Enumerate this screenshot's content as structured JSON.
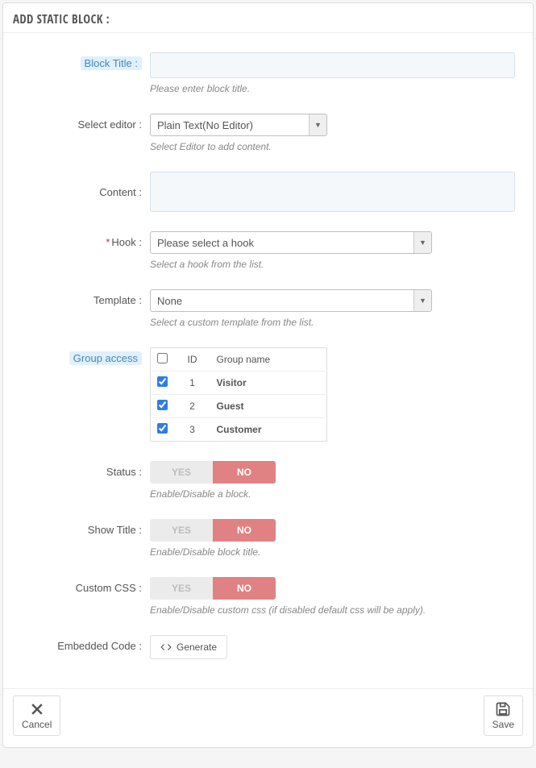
{
  "panel": {
    "title": "ADD STATIC BLOCK :"
  },
  "labels": {
    "block_title": "Block Title :",
    "select_editor": "Select editor :",
    "content": "Content :",
    "hook": "Hook :",
    "template": "Template :",
    "group_access": "Group access",
    "status": "Status :",
    "show_title": "Show Title :",
    "custom_css": "Custom CSS :",
    "embedded_code": "Embedded Code :"
  },
  "fields": {
    "block_title_value": "",
    "block_title_help": "Please enter block title.",
    "editor_value": "Plain Text(No Editor)",
    "editor_help": "Select Editor to add content.",
    "hook_value": "Please select a hook",
    "hook_help": "Select a hook from the list.",
    "template_value": "None",
    "template_help": "Select a custom template from the list.",
    "status_help": "Enable/Disable a block.",
    "show_title_help": "Enable/Disable block title.",
    "custom_css_help": "Enable/Disable custom css (if disabled default css will be apply).",
    "generate_label": "Generate"
  },
  "toggle": {
    "yes": "YES",
    "no": "NO"
  },
  "group_table": {
    "headers": {
      "id": "ID",
      "name": "Group name"
    },
    "rows": [
      {
        "id": "1",
        "name": "Visitor"
      },
      {
        "id": "2",
        "name": "Guest"
      },
      {
        "id": "3",
        "name": "Customer"
      }
    ]
  },
  "footer": {
    "cancel": "Cancel",
    "save": "Save"
  }
}
